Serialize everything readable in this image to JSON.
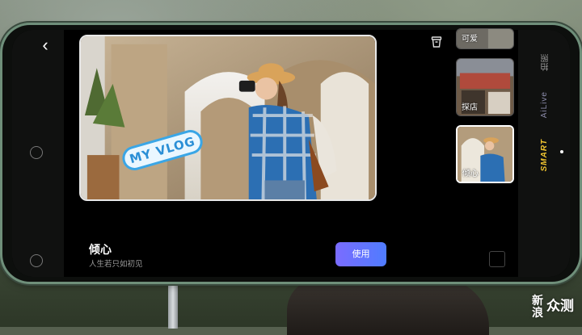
{
  "topbar": {
    "back_glyph": "‹",
    "trash_icon": "cup-icon"
  },
  "preview": {
    "sticker_text": "MY VLOG"
  },
  "template": {
    "title": "倾心",
    "subtitle": "人生若只如初见",
    "use_label": "使用"
  },
  "templates": [
    {
      "label": "可爱"
    },
    {
      "label": "探店"
    },
    {
      "label": "倾心"
    }
  ],
  "modes": {
    "photo": "拍照",
    "ailive": "AiLive",
    "smart": "SMART"
  },
  "watermark": {
    "small": "新浪",
    "big": "众测"
  },
  "colors": {
    "accent_start": "#7a6cff",
    "accent_end": "#4f7cff",
    "smart": "#f0c430"
  }
}
